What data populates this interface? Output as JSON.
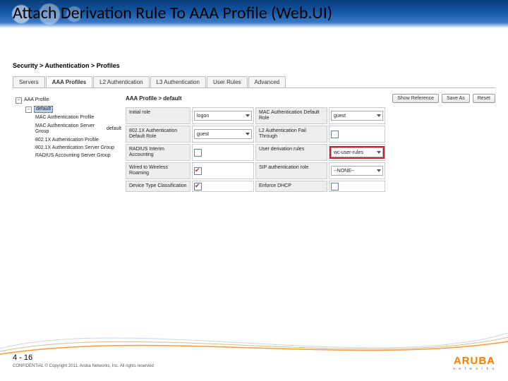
{
  "title": "Attach Derivation Rule To AAA Profile (Web.UI)",
  "breadcrumb": "Security > Authentication > Profiles",
  "tabs": [
    "Servers",
    "AAA Profiles",
    "L2 Authentication",
    "L3 Authentication",
    "User Rules",
    "Advanced"
  ],
  "active_tab": 1,
  "tree": {
    "root": "AAA Profile",
    "selected": "default",
    "children": [
      "MAC Authentication Profile",
      "MAC Authentication Server Group",
      "802.1X Authentication Profile",
      "802.1X Authentication Server Group",
      "RADIUS Accounting Server Group"
    ],
    "child_value": "default"
  },
  "main": {
    "heading": "AAA Profile > default",
    "buttons": {
      "show_ref": "Show Reference",
      "save_as": "Save As",
      "reset": "Reset"
    },
    "rows": [
      {
        "l1": "Initial role",
        "v1": {
          "type": "select",
          "value": "logon"
        },
        "l2": "MAC Authentication Default Role",
        "v2": {
          "type": "select",
          "value": "guest"
        }
      },
      {
        "l1": "802.1X Authentication Default Role",
        "v1": {
          "type": "select",
          "value": "guest"
        },
        "l2": "L2 Authentication Fail Through",
        "v2": {
          "type": "check",
          "checked": false
        }
      },
      {
        "l1": "RADIUS Interim Accounting",
        "v1": {
          "type": "check",
          "checked": false
        },
        "l2": "User derivation rules",
        "v2": {
          "type": "select",
          "value": "wc-user-rules",
          "highlight": true
        }
      },
      {
        "l1": "Wired to Wireless Roaming",
        "v1": {
          "type": "check",
          "checked": true
        },
        "l2": "SIP authentication role",
        "v2": {
          "type": "select",
          "value": "--NONE--"
        }
      },
      {
        "l1": "Device Type Classification",
        "v1": {
          "type": "check",
          "checked": true
        },
        "l2": "Enforce DHCP",
        "v2": {
          "type": "check",
          "checked": false
        }
      }
    ]
  },
  "footer": {
    "page": "4 - 16",
    "confidential": "CONFIDENTIAL © Copyright 2011. Aruba Networks, Inc. All rights reserved"
  },
  "logo": {
    "brand": "ARUBA",
    "sub": "n e t w o r k s"
  }
}
